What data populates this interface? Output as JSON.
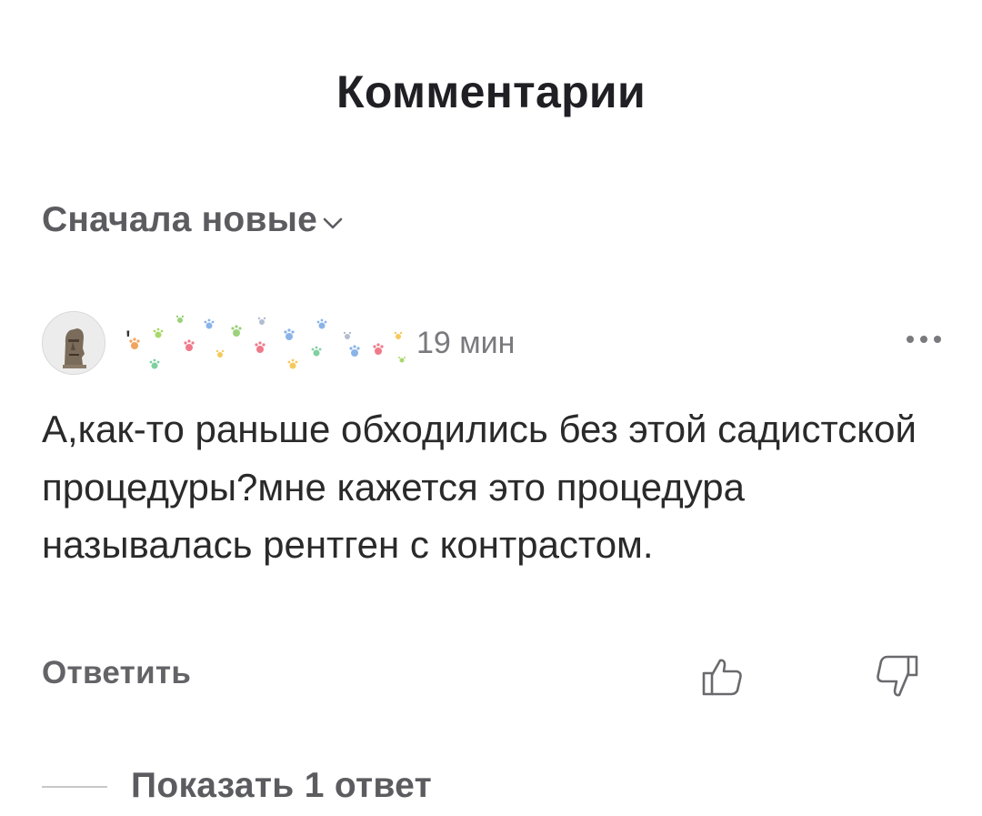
{
  "header": {
    "title": "Комментарии"
  },
  "sort": {
    "label": "Сначала новые",
    "icon": "chevron-down-icon"
  },
  "comment": {
    "username": "'",
    "time": "19 мин",
    "text": "А,как-то раньше обходились без этой садистской процедуры?мне кажется это процедура называлась рентген с контрастом.",
    "reply_label": "Ответить",
    "more_icon": "more-dots-icon",
    "like_icon": "thumbs-up-icon",
    "dislike_icon": "thumbs-down-icon"
  },
  "replies": {
    "show_label": "Показать 1 ответ"
  }
}
